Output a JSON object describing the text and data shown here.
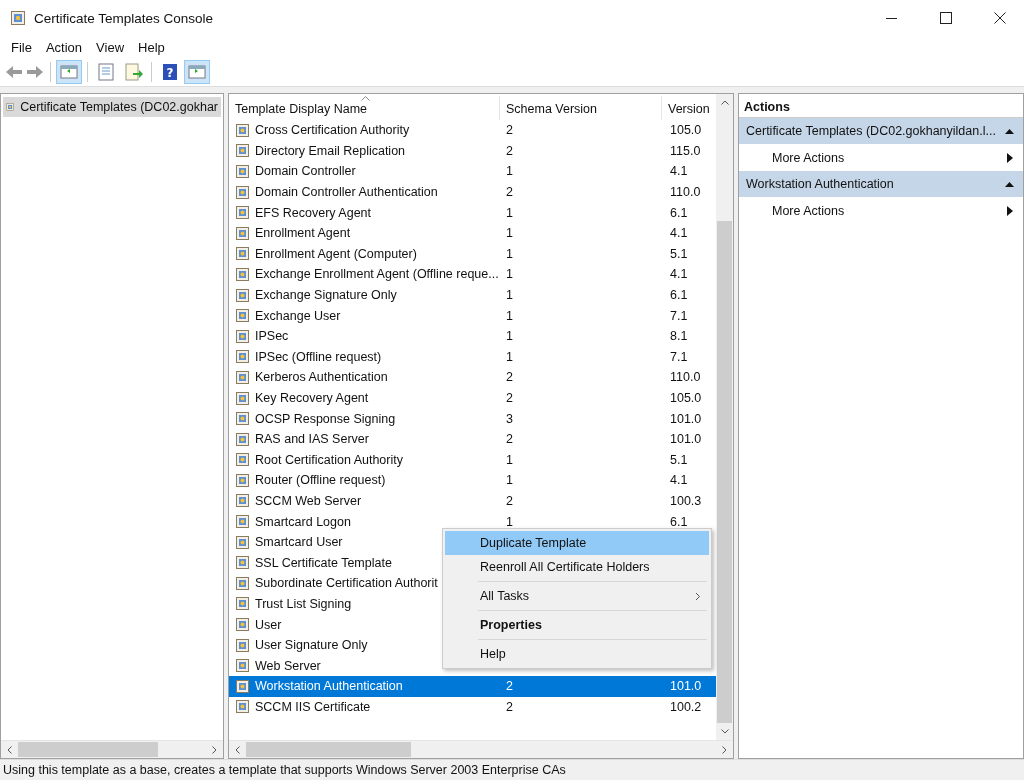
{
  "window": {
    "title": "Certificate Templates Console"
  },
  "menu_bar": [
    "File",
    "Action",
    "View",
    "Help"
  ],
  "toolbar": {
    "help_glyph": "?"
  },
  "tree": {
    "items": [
      {
        "label": "Certificate Templates (DC02.gokhar",
        "selected": true
      }
    ]
  },
  "table": {
    "columns": [
      "Template Display Name",
      "Schema Version",
      "Version"
    ],
    "rows": [
      {
        "name": "Cross Certification Authority",
        "schema_version": "2",
        "version": "105.0",
        "selected": false
      },
      {
        "name": "Directory Email Replication",
        "schema_version": "2",
        "version": "115.0",
        "selected": false
      },
      {
        "name": "Domain Controller",
        "schema_version": "1",
        "version": "4.1",
        "selected": false
      },
      {
        "name": "Domain Controller Authentication",
        "schema_version": "2",
        "version": "110.0",
        "selected": false
      },
      {
        "name": "EFS Recovery Agent",
        "schema_version": "1",
        "version": "6.1",
        "selected": false
      },
      {
        "name": "Enrollment Agent",
        "schema_version": "1",
        "version": "4.1",
        "selected": false
      },
      {
        "name": "Enrollment Agent (Computer)",
        "schema_version": "1",
        "version": "5.1",
        "selected": false
      },
      {
        "name": "Exchange Enrollment Agent (Offline reque...",
        "schema_version": "1",
        "version": "4.1",
        "selected": false
      },
      {
        "name": "Exchange Signature Only",
        "schema_version": "1",
        "version": "6.1",
        "selected": false
      },
      {
        "name": "Exchange User",
        "schema_version": "1",
        "version": "7.1",
        "selected": false
      },
      {
        "name": "IPSec",
        "schema_version": "1",
        "version": "8.1",
        "selected": false
      },
      {
        "name": "IPSec (Offline request)",
        "schema_version": "1",
        "version": "7.1",
        "selected": false
      },
      {
        "name": "Kerberos Authentication",
        "schema_version": "2",
        "version": "110.0",
        "selected": false
      },
      {
        "name": "Key Recovery Agent",
        "schema_version": "2",
        "version": "105.0",
        "selected": false
      },
      {
        "name": "OCSP Response Signing",
        "schema_version": "3",
        "version": "101.0",
        "selected": false
      },
      {
        "name": "RAS and IAS Server",
        "schema_version": "2",
        "version": "101.0",
        "selected": false
      },
      {
        "name": "Root Certification Authority",
        "schema_version": "1",
        "version": "5.1",
        "selected": false
      },
      {
        "name": "Router (Offline request)",
        "schema_version": "1",
        "version": "4.1",
        "selected": false
      },
      {
        "name": "SCCM Web Server",
        "schema_version": "2",
        "version": "100.3",
        "selected": false
      },
      {
        "name": "Smartcard Logon",
        "schema_version": "1",
        "version": "6.1",
        "selected": false
      },
      {
        "name": "Smartcard User",
        "selected": false
      },
      {
        "name": "SSL Certificate Template",
        "selected": false
      },
      {
        "name": "Subordinate Certification Authorit",
        "selected": false
      },
      {
        "name": "Trust List Signing",
        "selected": false
      },
      {
        "name": "User",
        "selected": false
      },
      {
        "name": "User Signature Only",
        "selected": false
      },
      {
        "name": "Web Server",
        "selected": false
      },
      {
        "name": "Workstation Authentication",
        "schema_version": "2",
        "version": "101.0",
        "selected": true
      },
      {
        "name": "SCCM IIS Certificate",
        "schema_version": "2",
        "version": "100.2",
        "selected": false
      }
    ]
  },
  "context_menu": {
    "items": [
      {
        "kind": "item",
        "label": "Duplicate Template",
        "selected": true
      },
      {
        "kind": "item",
        "label": "Reenroll All Certificate Holders",
        "selected": false
      },
      {
        "kind": "separator"
      },
      {
        "kind": "submenu",
        "label": "All Tasks",
        "selected": false
      },
      {
        "kind": "separator"
      },
      {
        "kind": "default",
        "label": "Properties",
        "selected": false
      },
      {
        "kind": "separator"
      },
      {
        "kind": "item",
        "label": "Help",
        "selected": false
      }
    ]
  },
  "actions": {
    "title": "Actions",
    "groups": [
      {
        "title": "Certificate Templates (DC02.gokhanyildan.l...",
        "expanded": true,
        "items": [
          "More Actions"
        ]
      },
      {
        "title": "Workstation Authentication",
        "expanded": true,
        "items": [
          "More Actions"
        ]
      }
    ]
  },
  "status_bar": "Using this template as a base, creates a template that supports Windows Server 2003 Enterprise CAs"
}
